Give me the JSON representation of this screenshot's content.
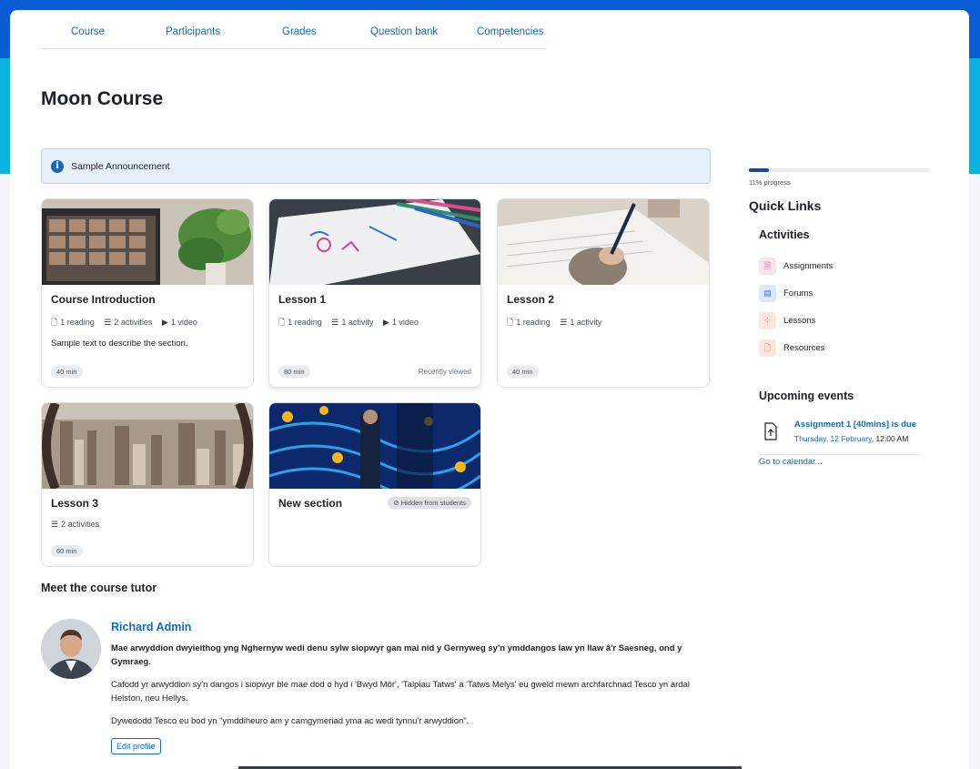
{
  "nav": {
    "items": [
      "Course",
      "Participants",
      "Grades",
      "Question bank",
      "Competencies"
    ]
  },
  "page_title": "Moon Course",
  "announcement": {
    "text": "Sample Announcement"
  },
  "cards": [
    {
      "title": "Course Introduction",
      "meta": [
        "1 reading",
        "2 activities",
        "1 video"
      ],
      "description": "Sample text to describe the section.",
      "duration": "40 min"
    },
    {
      "title": "Lesson 1",
      "meta": [
        "1 reading",
        "1 activity",
        "1 video"
      ],
      "duration": "80 min",
      "status": "Recently viewed"
    },
    {
      "title": "Lesson 2",
      "meta": [
        "1 reading",
        "1 activity"
      ],
      "duration": "40 min"
    },
    {
      "title": "Lesson 3",
      "meta": [
        "2 activities"
      ],
      "duration": "60 min"
    },
    {
      "title": "New section",
      "hidden_label": "Hidden from students"
    }
  ],
  "tutor": {
    "heading": "Meet the course tutor",
    "name": "Richard Admin",
    "bio_bold": "Mae arwyddion dwyieithog yng Nghernyw wedi denu sylw siopwyr gan mai nid y Gernyweg sy'n ymddangos law yn llaw â'r Saesneg, ond y Gymraeg.",
    "bio_p1": "Cafodd yr arwyddion sy'n dangos i siopwyr ble mae dod o hyd i 'Bwyd Môr', 'Talpiau Tatws' a 'Tatws Melys' eu gweld mewn archfarchnad Tesco yn ardal Helston, neu Hellys.",
    "bio_p2": "Dywedodd Tesco eu bod yn \"ymddiheuro am y camgymeriad yma ac wedi tynnu'r arwyddion\".",
    "edit_label": "Edit profile"
  },
  "sidebar": {
    "progress_percent": 11,
    "progress_text": "11% progress",
    "quick_links_title": "Quick Links",
    "activities_title": "Activities",
    "activities": [
      {
        "label": "Assignments",
        "icon": "assignment-icon",
        "bg": "#fbe3ee",
        "fg": "#c4317c"
      },
      {
        "label": "Forums",
        "icon": "forum-icon",
        "bg": "#dfe8fb",
        "fg": "#3f6ad8"
      },
      {
        "label": "Lessons",
        "icon": "lesson-icon",
        "bg": "#fde6dd",
        "fg": "#e05e2b"
      },
      {
        "label": "Resources",
        "icon": "resource-icon",
        "bg": "#fde6dd",
        "fg": "#e05e2b"
      }
    ],
    "events_title": "Upcoming events",
    "event": {
      "name": "Assignment 1 [40mins] is due",
      "date": "Thursday, 12 February",
      "time": "12:00 AM"
    },
    "calendar_link": "Go to calendar..."
  }
}
